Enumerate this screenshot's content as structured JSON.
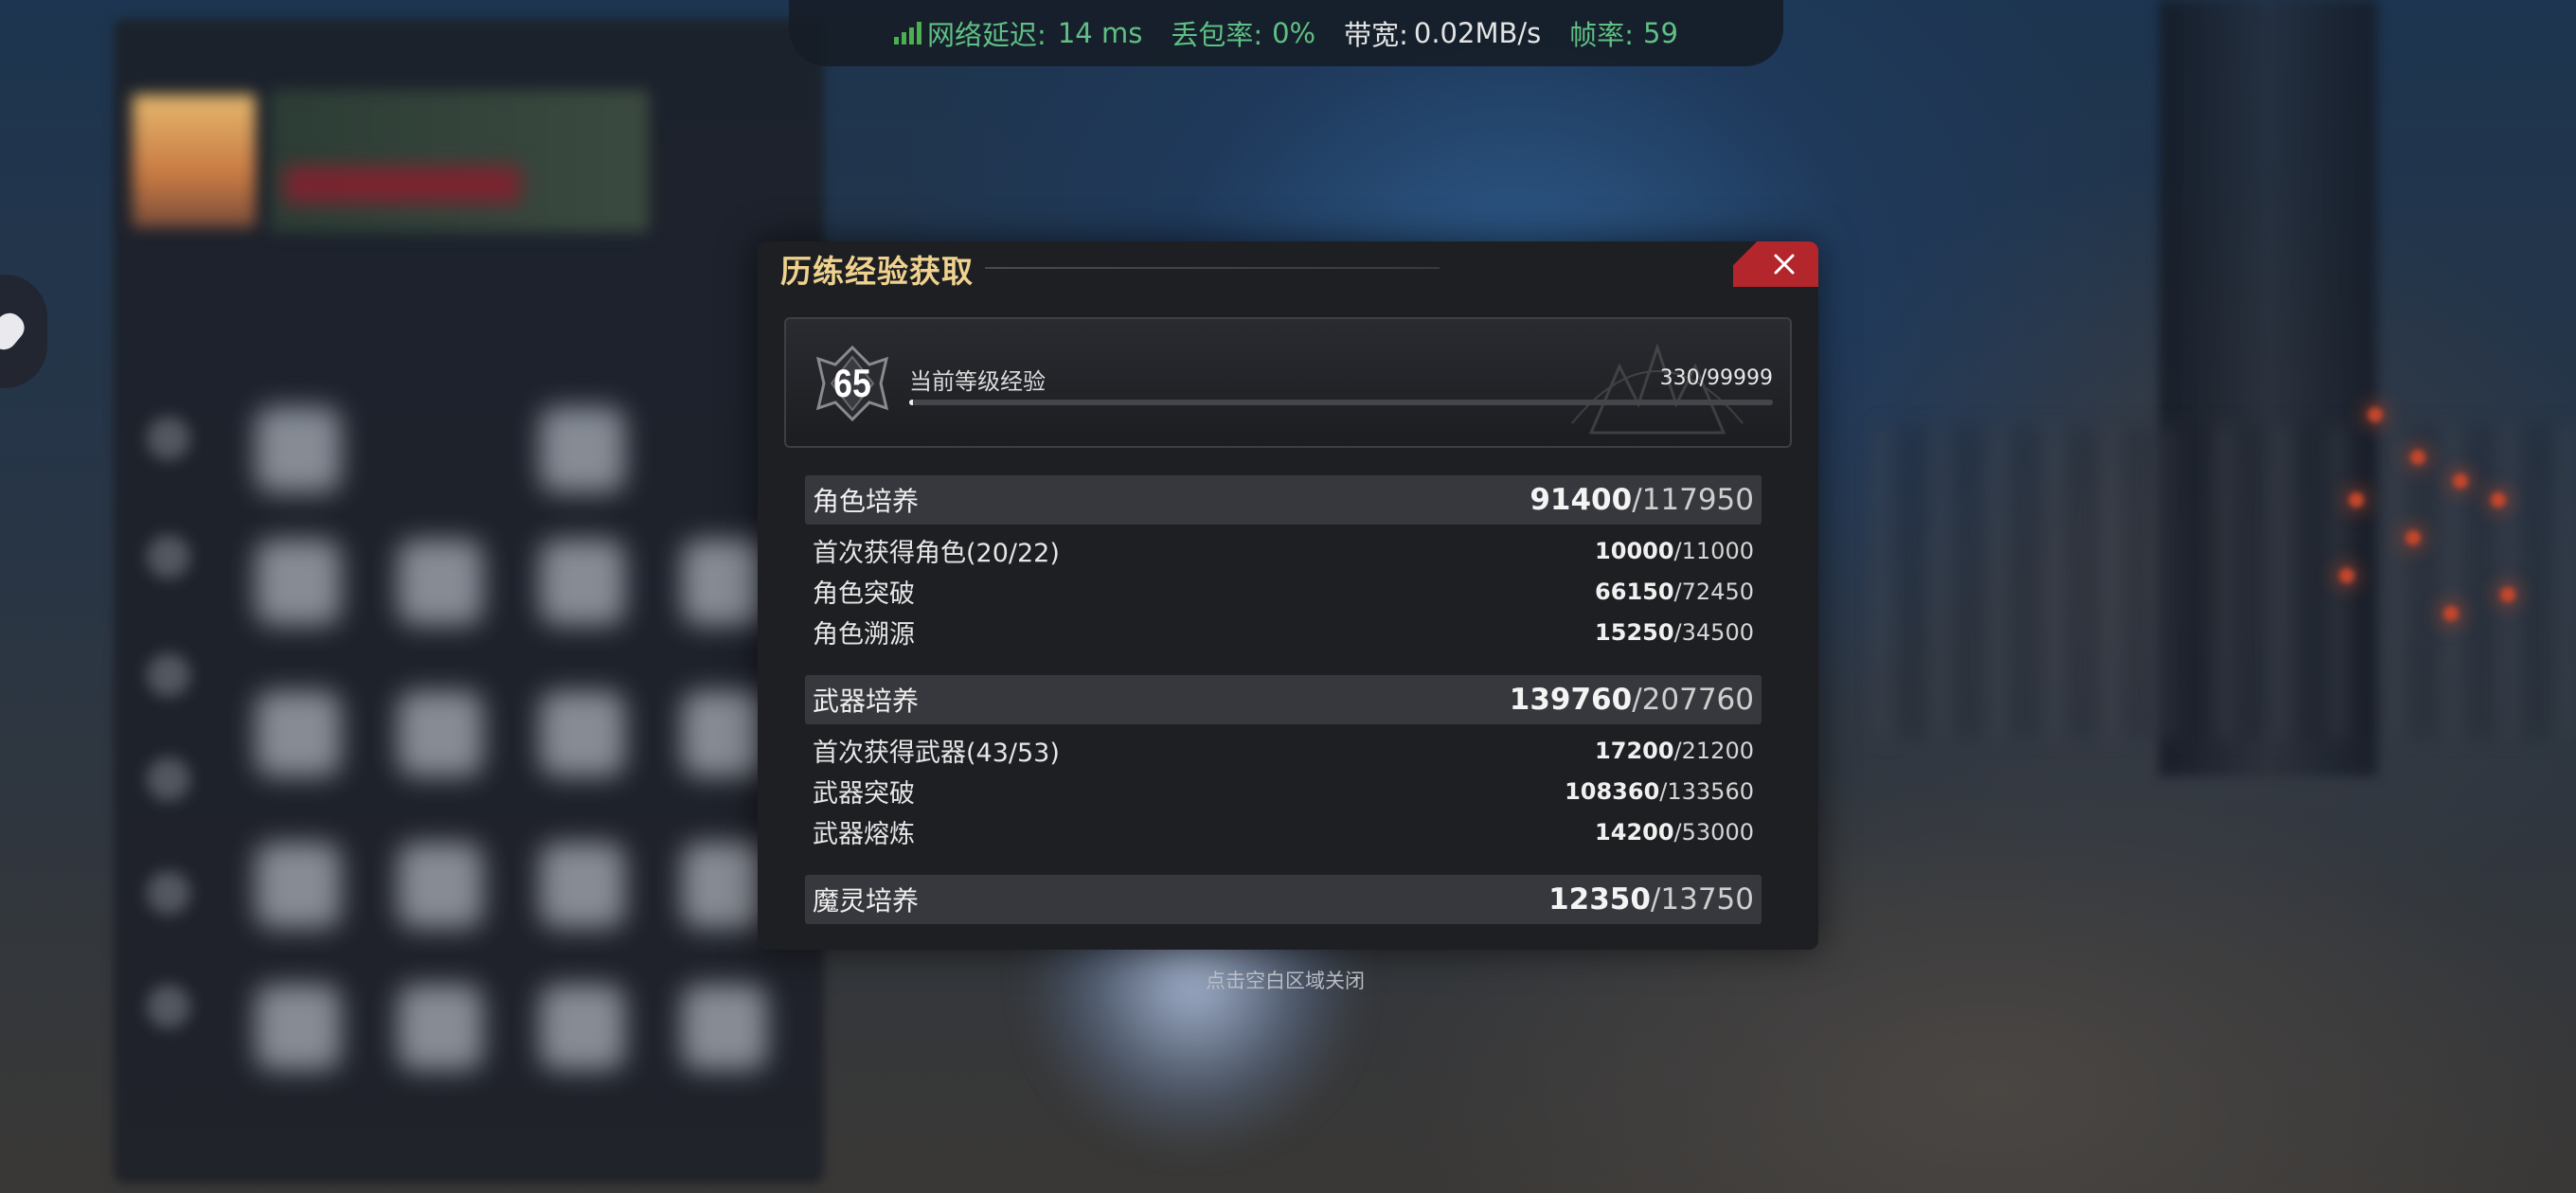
{
  "network": {
    "latency_label": "网络延迟:",
    "latency_value": "14 ms",
    "loss_label": "丢包率:",
    "loss_value": "0%",
    "bandwidth_label": "带宽:",
    "bandwidth_value": "0.02MB/s",
    "fps_label": "帧率:",
    "fps_value": "59",
    "signal_color": "#4caf50"
  },
  "dialog": {
    "title": "历练经验获取",
    "close_icon": "close-x-icon",
    "accent_color": "#b3262c",
    "title_color": "#efd28e"
  },
  "level": {
    "value": "65",
    "label": "当前等级经验",
    "current": "330",
    "max": "99999",
    "display": "330/99999",
    "progress_fraction": 0.0033
  },
  "sections": [
    {
      "name": "角色培养",
      "current": "91400",
      "total": "117950",
      "rows": [
        {
          "name": "首次获得角色(20/22)",
          "current": "10000",
          "total": "11000"
        },
        {
          "name": "角色突破",
          "current": "66150",
          "total": "72450"
        },
        {
          "name": "角色溯源",
          "current": "15250",
          "total": "34500"
        }
      ]
    },
    {
      "name": "武器培养",
      "current": "139760",
      "total": "207760",
      "rows": [
        {
          "name": "首次获得武器(43/53)",
          "current": "17200",
          "total": "21200"
        },
        {
          "name": "武器突破",
          "current": "108360",
          "total": "133560"
        },
        {
          "name": "武器熔炼",
          "current": "14200",
          "total": "53000"
        }
      ]
    },
    {
      "name": "魔灵培养",
      "current": "12350",
      "total": "13750",
      "rows": []
    }
  ],
  "separator": "/",
  "close_hint": "点击空白区域关闭"
}
